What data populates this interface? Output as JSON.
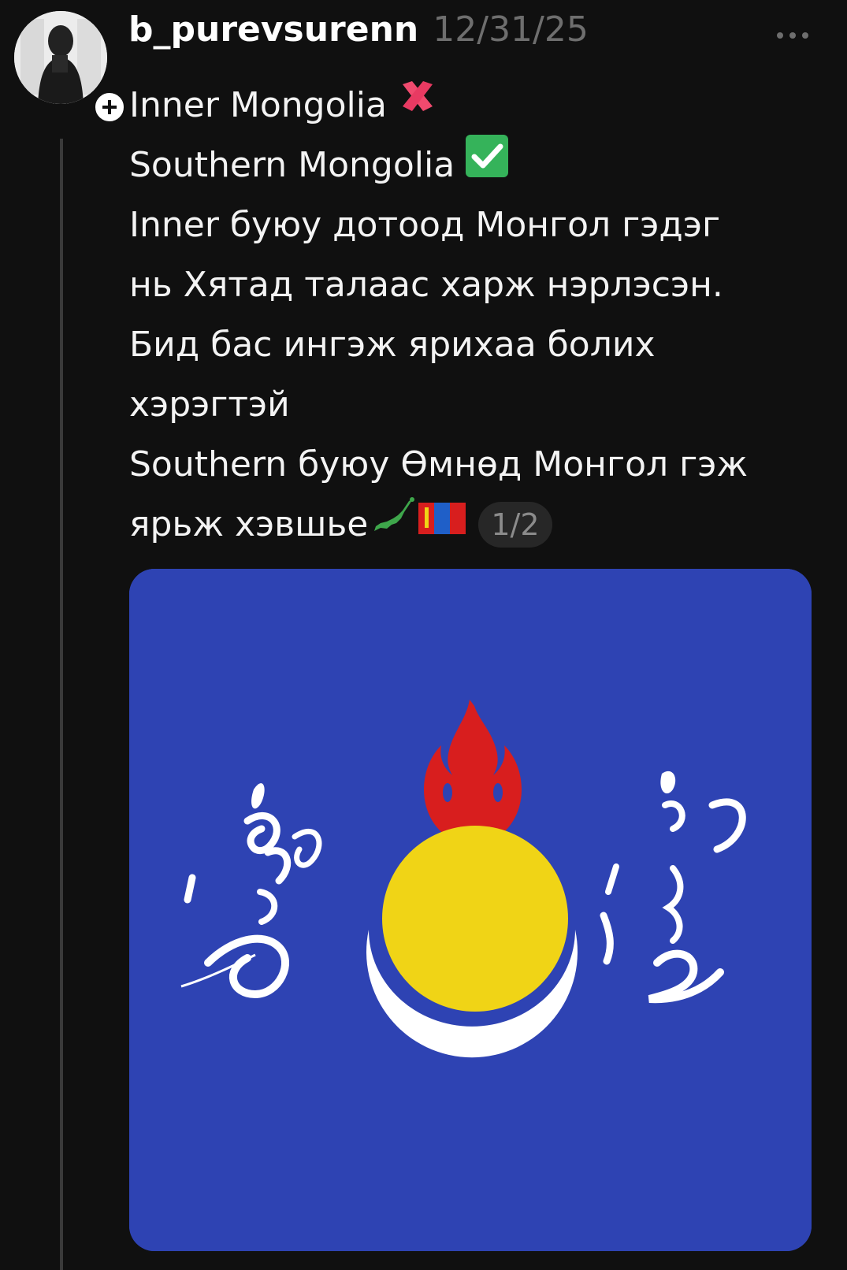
{
  "post": {
    "username": "b_purevsurenn",
    "timestamp": "12/31/25",
    "body_lines": [
      "Inner Mongolia",
      "Southern Mongolia",
      "Inner буюу дотоод Монгол гэдэг",
      "нь Хятад талаас харж нэрлэсэн.",
      "Бид бас ингэж ярихаа болих",
      "хэрэгтэй",
      "Southern буюу Өмнөд Монгол гэж",
      "ярьж хэвшье"
    ],
    "page_indicator": "1/2",
    "icons": {
      "line1_emoji": "cross-mark-icon",
      "line2_emoji": "check-mark-icon",
      "line8_emoji_1": "japan-map-icon",
      "line8_emoji_2": "mongolia-flag-icon",
      "more": "more-horizontal-icon",
      "follow": "plus-icon"
    }
  },
  "colors": {
    "background": "#101010",
    "text": "#f3f3f3",
    "muted": "#6e6e6e",
    "flag_blue": "#2e43b3",
    "flag_red": "#d81e1e",
    "flag_yellow": "#f0d416"
  }
}
